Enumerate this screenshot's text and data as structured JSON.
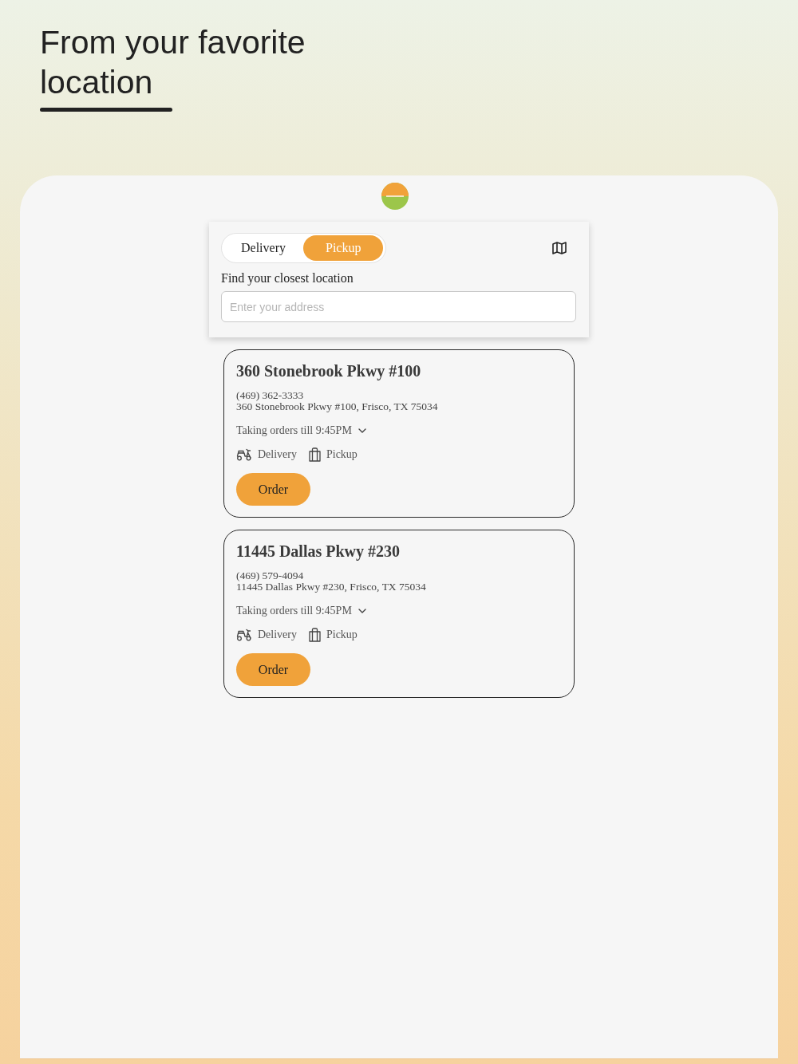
{
  "heading": {
    "title": "From your favorite location"
  },
  "finder": {
    "modes": [
      {
        "label": "Delivery",
        "selected": false
      },
      {
        "label": "Pickup",
        "selected": true
      }
    ],
    "label": "Find your closest location",
    "search": {
      "placeholder": "Enter your address"
    }
  },
  "locations": [
    {
      "name": "360 Stonebrook Pkwy #100",
      "phone": "(469) 362-3333",
      "address": "360 Stonebrook Pkwy #100, Frisco, TX 75034",
      "hours": "Taking orders till 9:45PM",
      "services": [
        {
          "kind": "delivery",
          "label": "Delivery"
        },
        {
          "kind": "pickup",
          "label": "Pickup"
        }
      ],
      "button": "Order"
    },
    {
      "name": "11445 Dallas Pkwy #230",
      "phone": "(469) 579-4094",
      "address": "11445 Dallas Pkwy #230, Frisco, TX 75034",
      "hours": "Taking orders till 9:45PM",
      "services": [
        {
          "kind": "delivery",
          "label": "Delivery"
        },
        {
          "kind": "pickup",
          "label": "Pickup"
        }
      ],
      "button": "Order"
    }
  ]
}
